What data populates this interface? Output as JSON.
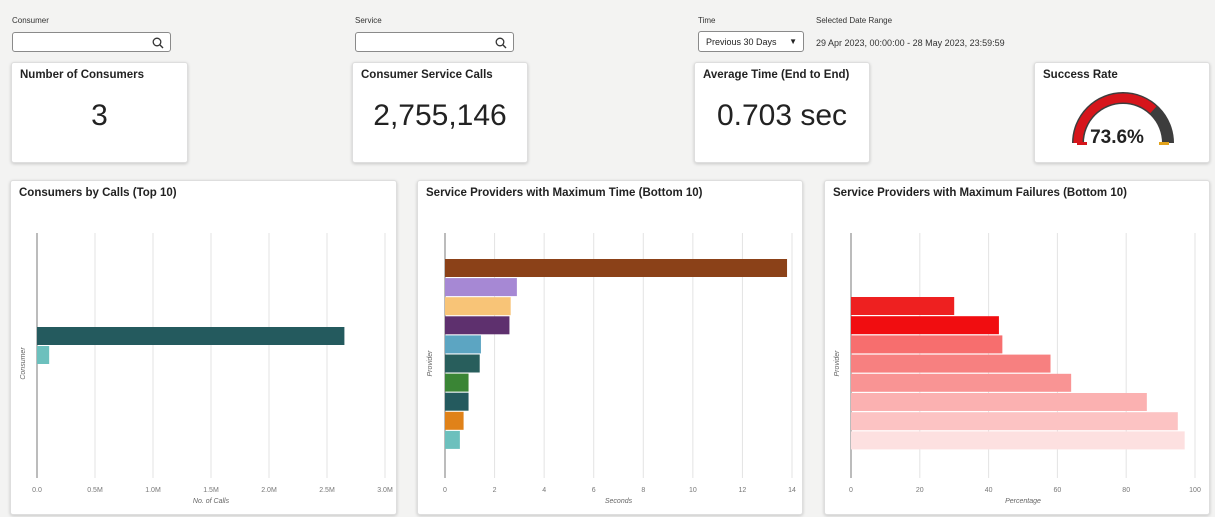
{
  "filters": {
    "consumer_label": "Consumer",
    "service_label": "Service",
    "time_label": "Time",
    "time_value": "Previous 30 Days",
    "date_range_label": "Selected Date Range",
    "date_range_value": "29 Apr 2023, 00:00:00 - 28 May 2023, 23:59:59"
  },
  "kpis": {
    "consumers": {
      "title": "Number of Consumers",
      "value": "3"
    },
    "calls": {
      "title": "Consumer Service Calls",
      "value": "2,755,146"
    },
    "avg_time": {
      "title": "Average Time (End to End)",
      "value": "0.703 sec"
    },
    "success": {
      "title": "Success Rate",
      "value": "73.6%",
      "fraction": 0.736
    }
  },
  "chart_data": [
    {
      "type": "bar",
      "orientation": "horizontal",
      "title": "Consumers by Calls (Top 10)",
      "xlabel": "No. of Calls",
      "ylabel": "Consumer",
      "xlim": [
        0,
        3000000
      ],
      "xticks": [
        "0.0",
        "0.5M",
        "1.0M",
        "1.5M",
        "2.0M",
        "2.5M",
        "3.0M"
      ],
      "values": [
        2650000,
        105000
      ],
      "colors": [
        "#245a5e",
        "#6cc0bd"
      ]
    },
    {
      "type": "bar",
      "orientation": "horizontal",
      "title": "Service Providers with Maximum Time (Bottom 10)",
      "xlabel": "Seconds",
      "ylabel": "Provider",
      "xlim": [
        0,
        14
      ],
      "xticks": [
        "0",
        "2",
        "4",
        "6",
        "8",
        "10",
        "12",
        "14"
      ],
      "values": [
        13.8,
        2.9,
        2.65,
        2.6,
        1.45,
        1.4,
        0.95,
        0.95,
        0.75,
        0.6
      ],
      "colors": [
        "#8b4118",
        "#a688d4",
        "#f8c477",
        "#5e306e",
        "#5ca5c2",
        "#285e5c",
        "#3a8535",
        "#245a5e",
        "#e08219",
        "#6cc0bd"
      ]
    },
    {
      "type": "bar",
      "orientation": "horizontal",
      "title": "Service Providers with Maximum Failures (Bottom 10)",
      "xlabel": "Percentage",
      "ylabel": "Provider",
      "xlim": [
        0,
        100
      ],
      "xticks": [
        "0",
        "20",
        "40",
        "60",
        "80",
        "100"
      ],
      "values": [
        30,
        43,
        44,
        58,
        64,
        86,
        95,
        97
      ],
      "colors": [
        "#ee2020",
        "#f10d10",
        "#f76e6e",
        "#f78080",
        "#f99494",
        "#fbb1b1",
        "#fcc3c3",
        "#fde0e0"
      ]
    }
  ]
}
